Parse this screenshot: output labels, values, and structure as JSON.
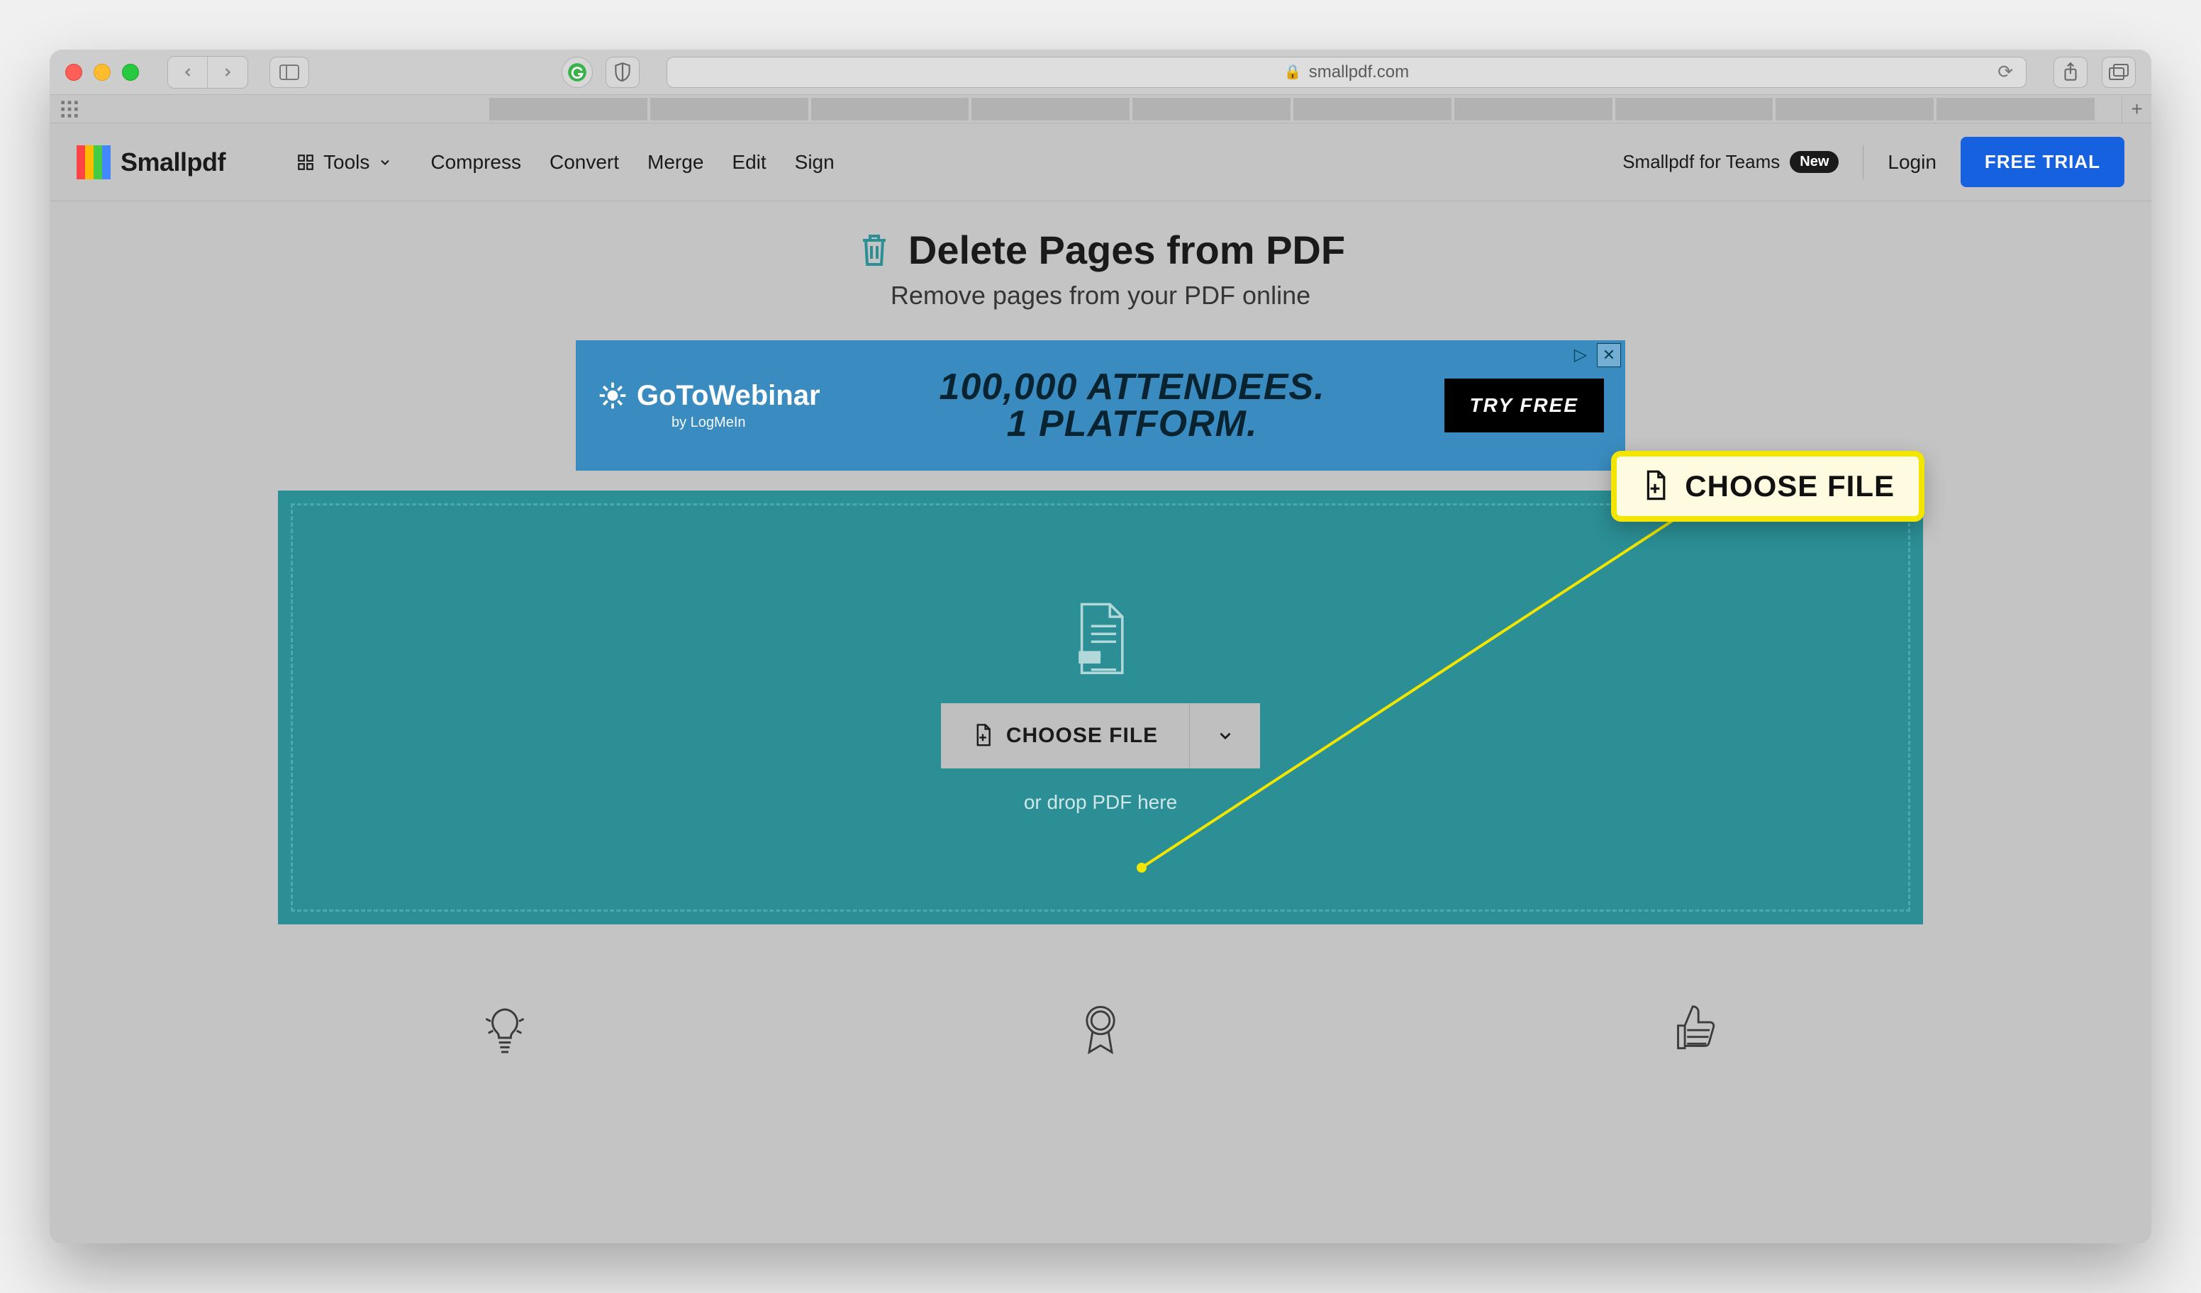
{
  "browser": {
    "url_display": "smallpdf.com"
  },
  "header": {
    "brand": "Smallpdf",
    "tools_label": "Tools",
    "links": [
      "Compress",
      "Convert",
      "Merge",
      "Edit",
      "Sign"
    ],
    "teams_label": "Smallpdf for Teams",
    "teams_badge": "New",
    "login_label": "Login",
    "cta_label": "FREE TRIAL"
  },
  "hero": {
    "title": "Delete Pages from PDF",
    "subtitle": "Remove pages from your PDF online"
  },
  "ad": {
    "brand_name": "GoToWebinar",
    "brand_byline": "by LogMeIn",
    "line1": "100,000 ATTENDEES.",
    "line2": "1 PLATFORM.",
    "cta": "TRY FREE"
  },
  "dropzone": {
    "button_label": "CHOOSE FILE",
    "hint": "or drop PDF here"
  },
  "callout": {
    "label": "CHOOSE FILE"
  }
}
